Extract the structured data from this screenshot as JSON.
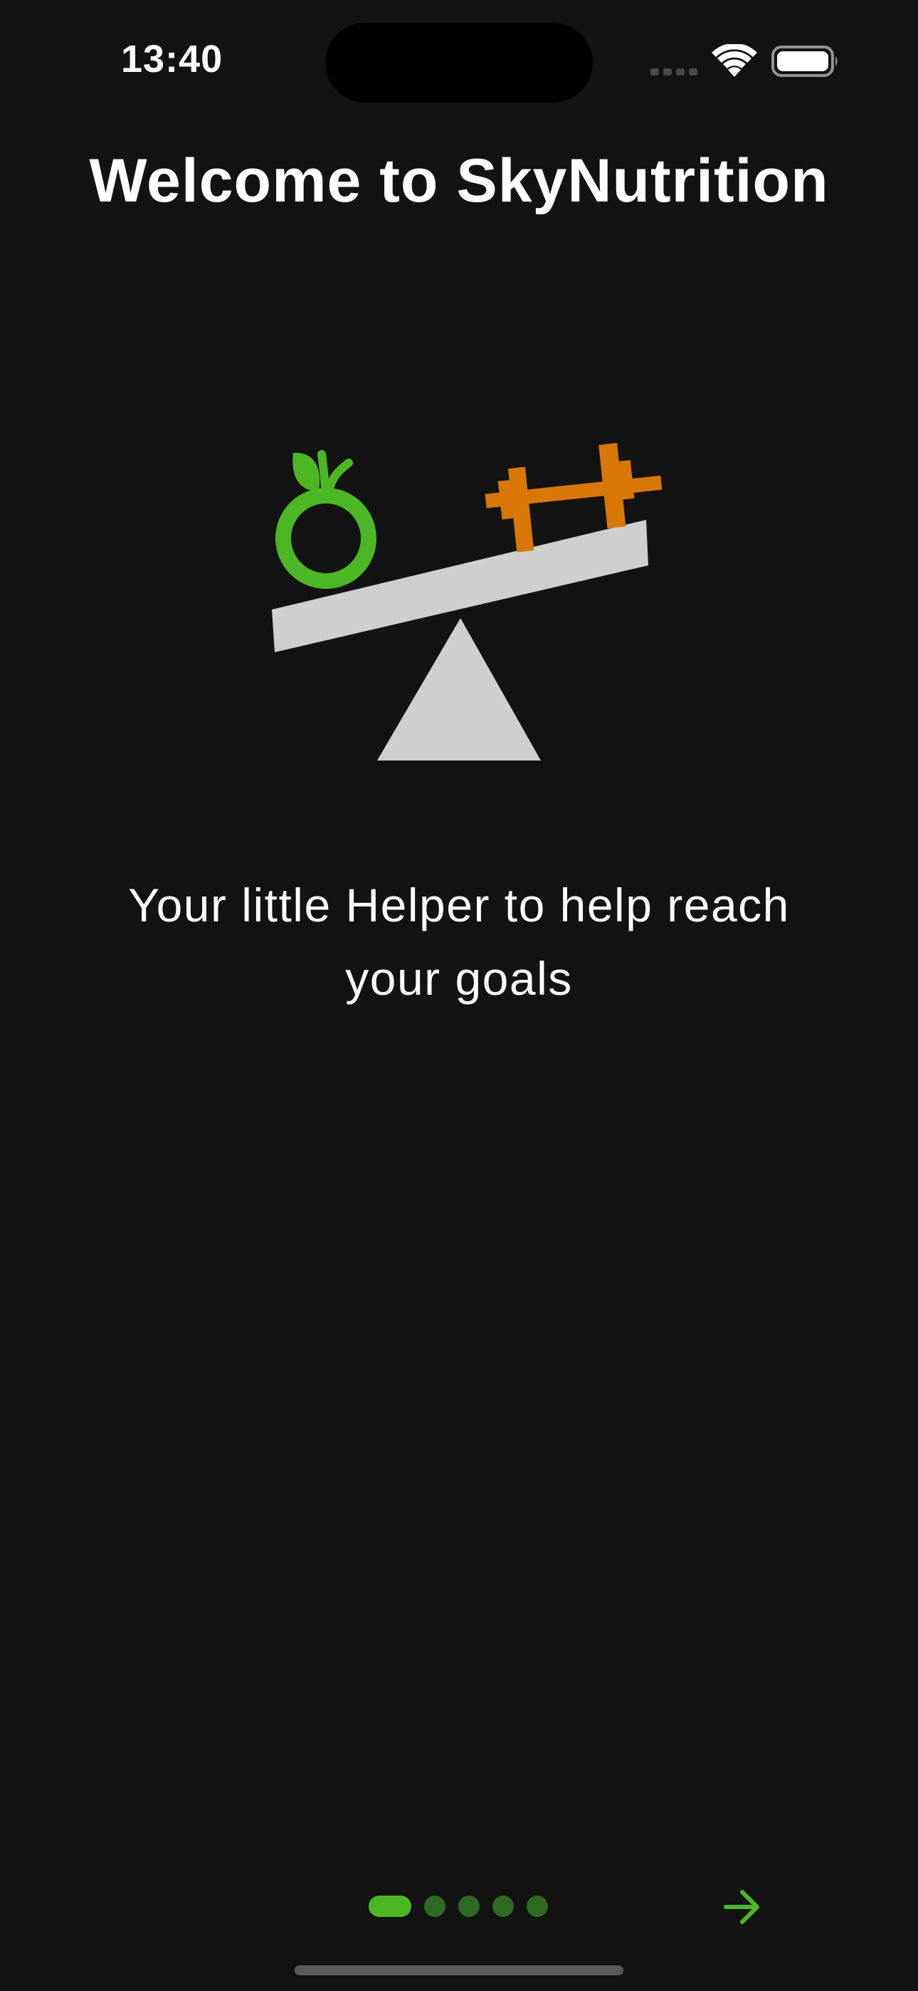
{
  "status_bar": {
    "time": "13:40"
  },
  "onboarding": {
    "title": "Welcome to SkyNutrition",
    "tagline_line1": "Your little Helper to help reach",
    "tagline_line2": "your goals",
    "illustration_icons": [
      "apple-icon",
      "dumbbell-icon",
      "seesaw-balance-icon"
    ],
    "page_indicator": {
      "total_pages": 5,
      "current_page": 1
    },
    "next_icon": "arrow-right-icon"
  },
  "colors": {
    "background": "#131313",
    "accent_green": "#4cb725",
    "inactive_dot": "#2f6a22",
    "dumbbell_orange": "#d97706",
    "seesaw_gray": "#cfcfcf"
  }
}
